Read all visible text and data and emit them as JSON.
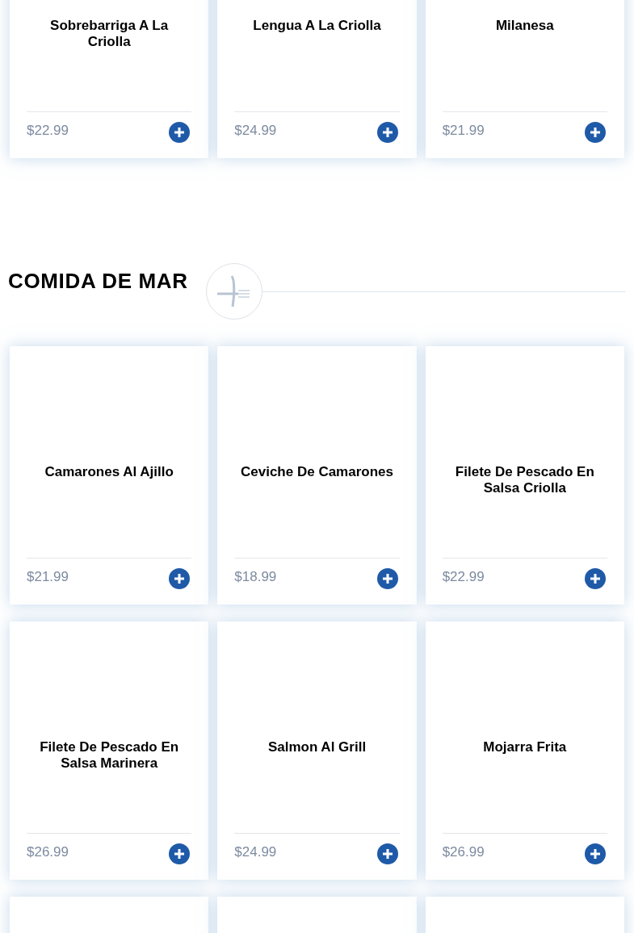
{
  "sections": [
    {
      "items": [
        {
          "kind": "dish",
          "name": "Sobrebarriga A La Criolla",
          "price": "$22.99"
        },
        {
          "kind": "dish",
          "name": "Lengua A La Criolla",
          "price": "$24.99"
        },
        {
          "kind": "dish",
          "name": "Milanesa",
          "price": "$21.99"
        }
      ]
    },
    {
      "title": "COMIDA DE MAR",
      "items": [
        {
          "kind": "dish",
          "name": "Camarones Al Ajillo",
          "price": "$21.99"
        },
        {
          "kind": "dish",
          "name": "Ceviche De Camarones",
          "price": "$18.99"
        },
        {
          "kind": "dish",
          "name": "Filete De Pescado En Salsa Criolla",
          "price": "$22.99"
        },
        {
          "kind": "dish",
          "name": "Filete De Pescado En Salsa Marinera",
          "price": "$26.99"
        },
        {
          "kind": "dish",
          "name": "Salmon Al Grill",
          "price": "$24.99"
        },
        {
          "kind": "dish",
          "name": "Mojarra Frita",
          "price": "$26.99"
        },
        {
          "kind": "cut"
        },
        {
          "kind": "cut"
        },
        {
          "kind": "cut"
        }
      ]
    }
  ]
}
